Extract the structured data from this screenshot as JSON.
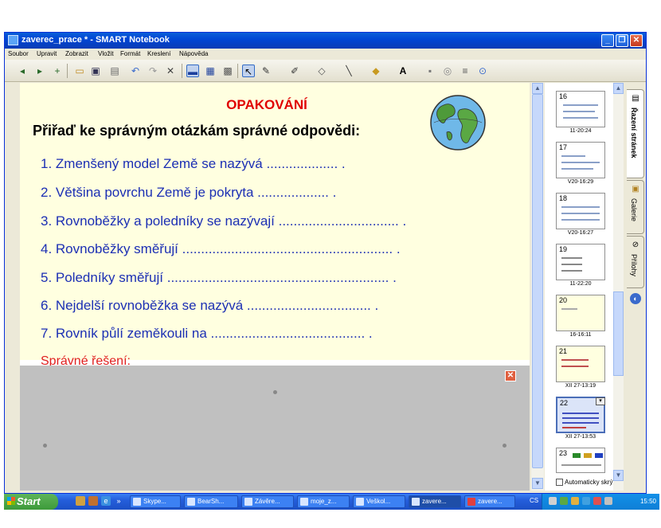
{
  "window": {
    "title": "zaverec_prace * - SMART Notebook",
    "minimize": "_",
    "maximize": "❐",
    "close": "✕"
  },
  "menu": [
    "Soubor",
    "Upravit",
    "Zobrazit",
    "Vložit",
    "Formát",
    "Kreslení",
    "Nápověda"
  ],
  "slide": {
    "heading": "OPAKOVÁNÍ",
    "instruction": "Přiřaď ke správným otázkám správné odpovědi:",
    "questions": [
      "1. Zmenšený model Země se nazývá ................... .",
      "2. Většina povrchu Země je pokryta ................... .",
      "3. Rovnoběžky a poledníky se nazývají ................................ .",
      "4. Rovnoběžky směřují ........................................................ .",
      "5. Poledníky směřují ........................................................... .",
      "6. Nejdelší rovnoběžka se nazývá ................................. .",
      "7. Rovník půlí zeměkouli na ......................................... ."
    ],
    "solution_label": "Správné řešení:",
    "shade_close": "✕"
  },
  "sorter": {
    "pages": [
      {
        "num": "16",
        "stamp": "11-20:24"
      },
      {
        "num": "17",
        "stamp": "V20-16:29"
      },
      {
        "num": "18",
        "stamp": "V20-16:27"
      },
      {
        "num": "19",
        "stamp": "11-22:20"
      },
      {
        "num": "20",
        "stamp": "16-16:11"
      },
      {
        "num": "21",
        "stamp": "XII 27-13:19"
      },
      {
        "num": "22",
        "stamp": "XII 27-13:53"
      },
      {
        "num": "23",
        "stamp": ""
      }
    ],
    "current_index": 6,
    "autohide_label": "Automaticky skrýt"
  },
  "sidetabs": [
    {
      "label": "Řazení stránek",
      "icon": "page-sorter-icon"
    },
    {
      "label": "Galerie",
      "icon": "gallery-icon"
    },
    {
      "label": "Přílohy",
      "icon": "attachments-icon"
    }
  ],
  "taskbar": {
    "start": "Start",
    "tasks": [
      "Skype...",
      "BearSh...",
      "Závěre...",
      "moje_z...",
      "Veškol...",
      "zavere...",
      "zavere..."
    ],
    "active_task": 5,
    "lang": "CS",
    "clock": "15:50"
  }
}
